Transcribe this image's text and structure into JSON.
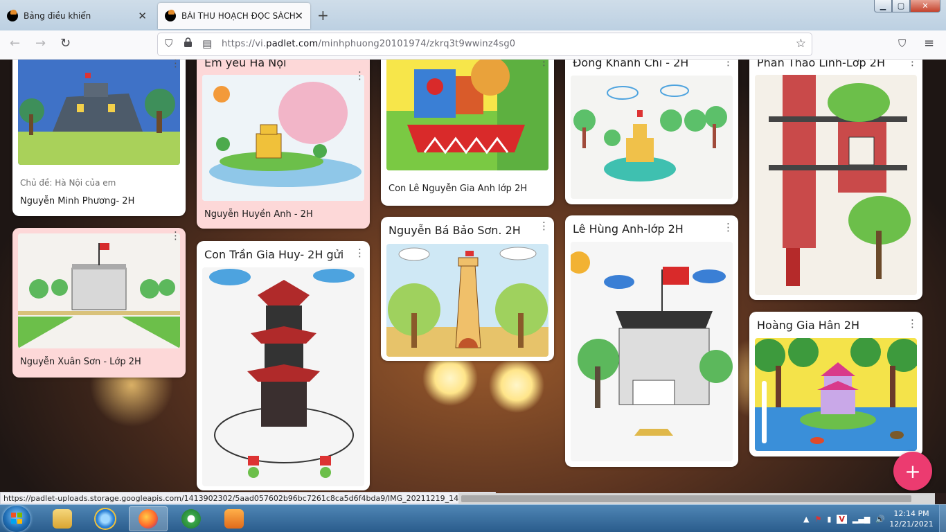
{
  "browser": {
    "tabs": [
      {
        "label": "Bảng điều khiển",
        "active": false
      },
      {
        "label": "BÀI THU HOẠCH ĐỌC SÁCH THÁNG",
        "active": true
      }
    ],
    "url_prefix": "https://vi.",
    "url_domain": "padlet.com",
    "url_path": "/minhphuong20101974/zkrq3t9wwinz4sg0",
    "status_url": "https://padlet-uploads.storage.googleapis.com/1413902302/5aad057602b96bc7261c8ca5d6f4bda9/IMG_20211219_144902.jpg"
  },
  "icons": {
    "back": "←",
    "forward": "→",
    "reload": "↻",
    "shield": "⛉",
    "lock": "🔒",
    "permissions": "▤",
    "star": "☆",
    "pocket": "⛉",
    "menu": "≡",
    "plus": "+",
    "more": "⋮",
    "close": "✕",
    "minimize": "▁",
    "maximize": "▢"
  },
  "posts": [
    {
      "id": "p1",
      "title": "",
      "subtitle": "Chủ đề: Hà Nội của em",
      "caption": "Nguyễn Minh Phương- 2H"
    },
    {
      "id": "p2",
      "title": "",
      "subtitle": "",
      "caption": "Nguyễn Xuân Sơn - Lớp 2H"
    },
    {
      "id": "p3",
      "title": "Em yêu Hà Nội",
      "subtitle": "",
      "caption": "Nguyễn Huyền Anh - 2H"
    },
    {
      "id": "p4",
      "title": "Con Trần Gia Huy- 2H gửi",
      "subtitle": "",
      "caption": ""
    },
    {
      "id": "p5",
      "title": "",
      "subtitle": "",
      "caption": "Con Lê Nguyễn Gia Anh lớp 2H"
    },
    {
      "id": "p6",
      "title": "Nguyễn Bá Bảo Sơn. 2H",
      "subtitle": "",
      "caption": ""
    },
    {
      "id": "p7",
      "title": "Đông Khánh Chi - 2H",
      "subtitle": "",
      "caption": ""
    },
    {
      "id": "p8",
      "title": "Lê Hùng Anh-lớp 2H",
      "subtitle": "",
      "caption": ""
    },
    {
      "id": "p9",
      "title": "Phan Thảo Linh-Lớp 2H",
      "subtitle": "",
      "caption": ""
    },
    {
      "id": "p10",
      "title": "Hoàng Gia Hân 2H",
      "subtitle": "",
      "caption": ""
    }
  ],
  "taskbar": {
    "time": "12:14 PM",
    "date": "12/21/2021",
    "apps": [
      "explorer",
      "internet-explorer",
      "firefox",
      "coccoc",
      "media-player"
    ]
  },
  "colors": {
    "fab": "#ec3b70",
    "pink_card": "#fdd8d8"
  }
}
